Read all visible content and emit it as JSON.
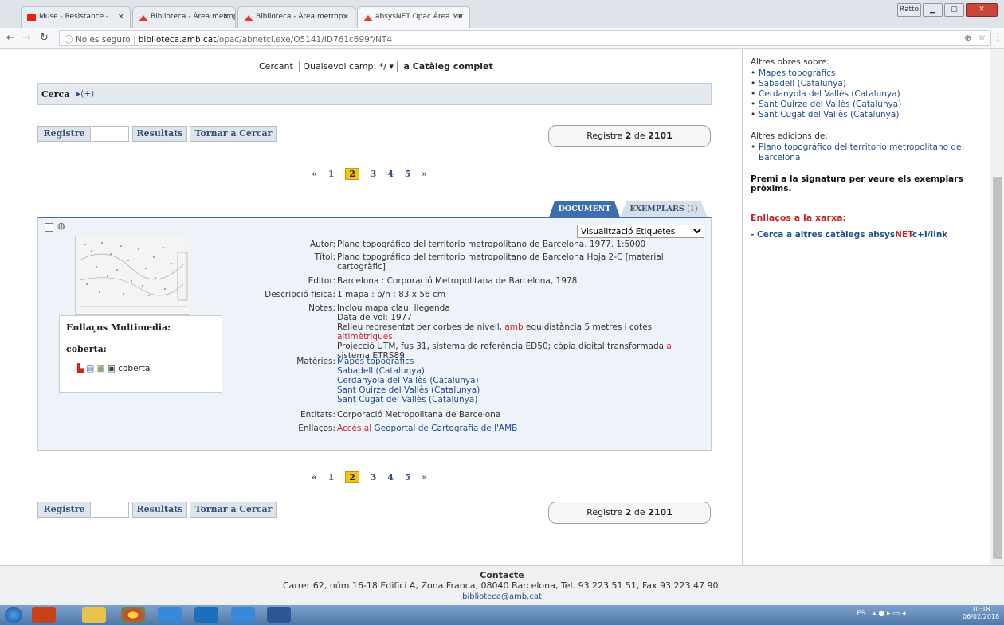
{
  "browser": {
    "tabs": [
      {
        "label": "Muse - Resistance - ",
        "icon": "youtube-icon"
      },
      {
        "label": "Biblioteca - Àrea metrop",
        "icon": "amb-icon"
      },
      {
        "label": "Biblioteca - Àrea metrop",
        "icon": "amb-icon"
      },
      {
        "label": "absysNET Opac Àrea Me",
        "icon": "amb-icon"
      }
    ],
    "window_user": "Ratto",
    "address": {
      "security": "No es seguro",
      "domain": "biblioteca.amb.cat",
      "path": "/opac/abnetcl.exe/O5141/ID761c699f/NT4"
    }
  },
  "search": {
    "prefix": "Cercant",
    "field_select": "Qualsevol camp: */",
    "suffix": "a Catàleg complet",
    "cerca_label": "Cerca",
    "cerca_toggle": "(+)"
  },
  "toolbar": {
    "registre": "Registre",
    "resultats": "Resultats",
    "tornar": "Tornar a Cercar",
    "reg_prefix": "Registre",
    "reg_num": "2",
    "reg_mid": "de",
    "reg_total": "2101"
  },
  "pager": {
    "prev": "«",
    "pages": [
      "1",
      "2",
      "3",
      "4",
      "5"
    ],
    "current": "2",
    "next": "»"
  },
  "record_tabs": {
    "document": "DOCUMENT",
    "exemplars": "EXEMPLARS",
    "exemplars_count": "(1)"
  },
  "record": {
    "view_select": "Visualització Etiquetes",
    "multimedia_title": "Enllaços Multimedia:",
    "cover_title": "coberta:",
    "cover_link": "coberta",
    "fields": {
      "autor_k": "Autor:",
      "autor_v": "Plano topográfico del territorio metropolitano de Barcelona. 1977. 1:5000",
      "titol_k": "Títol:",
      "titol_v": "Plano topográfico del territorio metropolitano de Barcelona Hoja 2-C [material cartogràfic]",
      "editor_k": "Editor:",
      "editor_v": "Barcelona : Corporació Metropolitana de Barcelona, 1978",
      "desc_k": "Descripció física:",
      "desc_v": "1 mapa : b/n ; 83 x 56 cm",
      "notes_k": "Notes:",
      "notes_1": "Inclou mapa clau; llegenda",
      "notes_2": "Data de vol: 1977",
      "notes_3a": "Relleu representat per corbes de nivell, ",
      "notes_3b": "amb",
      "notes_3c": " equidistància 5 metres i cotes ",
      "notes_3d": "altimètriques",
      "notes_4a": "Projecció UTM, fus 31, sistema de referència ED50; còpia digital transformada ",
      "notes_4b": "a",
      "notes_4c": " sistema ETRS89",
      "materies_k": "Matèries:",
      "materies": [
        "Mapes topogràfics",
        "Sabadell (Catalunya)",
        "Cerdanyola del Vallès (Catalunya)",
        "Sant Quirze del Vallès (Catalunya)",
        "Sant Cugat del Vallès (Catalunya)"
      ],
      "entitats_k": "Entitats:",
      "entitats_v": "Corporació Metropolitana de Barcelona",
      "enllacos_k": "Enllaços:",
      "enllacos_a": "Accés al",
      "enllacos_b": " Geoportal de Cartografia de l'AMB"
    }
  },
  "sidebar": {
    "altres_obres": "Altres obres sobre:",
    "obres": [
      "Mapes topogràfics",
      "Sabadell (Catalunya)",
      "Cerdanyola del Vallès (Catalunya)",
      "Sant Quirze del Vallès (Catalunya)",
      "Sant Cugat del Vallès (Catalunya)"
    ],
    "altres_edicions": "Altres edicions de:",
    "edicions": [
      "Plano topográfico del territorio metropolitano de Barcelona"
    ],
    "premi": "Premi a la signatura per veure els exemplars pròxims.",
    "enllacos_title": "Enllaços a la xarxa:",
    "cerca_a": "- Cerca a altres catàlegs absys",
    "cerca_net": "NET",
    "cerca_b": "c+I/link"
  },
  "footer": {
    "title": "Contacte",
    "address": "Carrer 62, núm 16-18 Edifici A, Zona Franca, 08040 Barcelona, Tel. 93 223 51 51, Fax 93 223 47 90.",
    "email": "biblioteca@amb.cat"
  },
  "taskbar": {
    "lang": "ES",
    "time": "10:18",
    "date": "06/02/2018"
  },
  "colors": {
    "accent": "#3d6fb0",
    "link": "#1f4e8c",
    "red": "#c72626",
    "page_highlight": "#f3c31c"
  }
}
